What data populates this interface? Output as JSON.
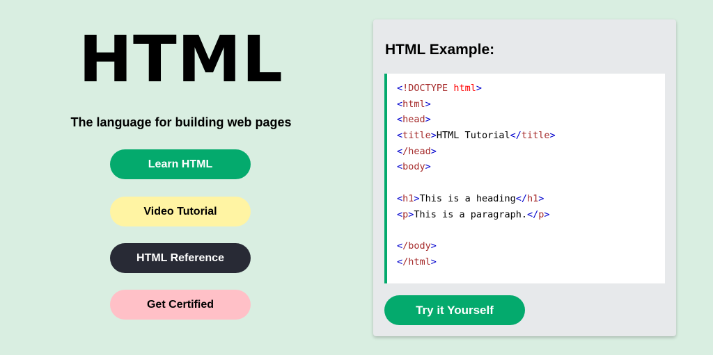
{
  "hero": {
    "title": "HTML",
    "tagline": "The language for building web pages"
  },
  "buttons": {
    "learn": "Learn HTML",
    "video": "Video Tutorial",
    "reference": "HTML Reference",
    "certified": "Get Certified"
  },
  "example": {
    "title": "HTML Example:",
    "code": {
      "doctype": "!DOCTYPE",
      "doctype_value": "html",
      "html_open": "html",
      "head_open": "head",
      "title_tag": "title",
      "title_text": "HTML Tutorial",
      "head_close": "/head",
      "body_open": "body",
      "h1_tag": "h1",
      "h1_text": "This is a heading",
      "p_tag": "p",
      "p_text": "This is a paragraph.",
      "body_close": "/body",
      "html_close": "/html"
    },
    "try_button": "Try it Yourself"
  },
  "colors": {
    "background": "#d9eee1",
    "green": "#04aa6d",
    "yellow": "#fff4a3",
    "dark": "#282a35",
    "pink": "#ffc0c7",
    "card": "#e7e9eb"
  }
}
